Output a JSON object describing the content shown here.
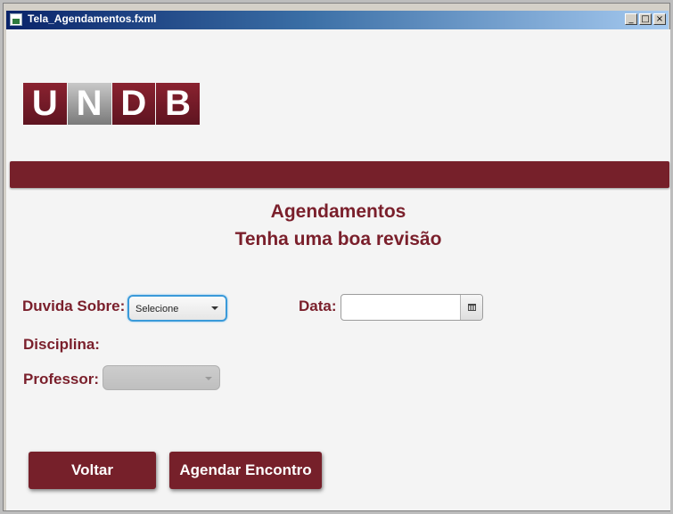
{
  "window": {
    "title": "Tela_Agendamentos.fxml",
    "controls": [
      "_",
      "□",
      "×"
    ]
  },
  "logo": {
    "letters": [
      "U",
      "N",
      "D",
      "B"
    ]
  },
  "header": {
    "line1": "Agendamentos",
    "line2": "Tenha uma boa revisão"
  },
  "form": {
    "duvida_label": "Duvida Sobre:",
    "duvida_value": "Selecione",
    "data_label": "Data:",
    "data_value": "",
    "disciplina_label": "Disciplina:",
    "professor_label": "Professor:"
  },
  "buttons": {
    "voltar": "Voltar",
    "agendar": "Agendar Encontro"
  },
  "colors": {
    "brand": "#76202a",
    "heading": "#7a1f2b",
    "focus": "#3a9ad9"
  }
}
